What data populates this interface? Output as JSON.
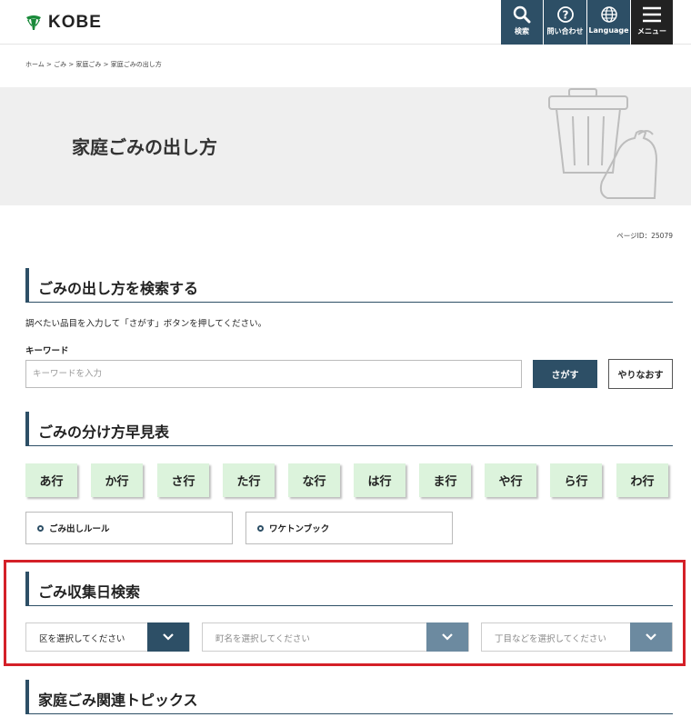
{
  "header": {
    "logo_text": "KOBE",
    "buttons": [
      {
        "label": "検索",
        "icon": "search-icon"
      },
      {
        "label": "問い合わせ",
        "icon": "question-icon"
      },
      {
        "label": "Language",
        "icon": "globe-icon"
      },
      {
        "label": "メニュー",
        "icon": "hamburger-menu-icon"
      }
    ]
  },
  "breadcrumb": "ホーム > ごみ > 家庭ごみ > 家庭ごみの出し方",
  "page_title": "家庭ごみの出し方",
  "page_id": "ページID：25079",
  "search_section": {
    "heading": "ごみの出し方を検索する",
    "intro": "調べたい品目を入力して「さがす」ボタンを押してください。",
    "keyword_label": "キーワード",
    "keyword_placeholder": "キーワードを入力",
    "search_button": "さがす",
    "reset_button": "やりなおす"
  },
  "sorting_section": {
    "heading": "ごみの分け方早見表",
    "rows": [
      "あ行",
      "か行",
      "さ行",
      "た行",
      "な行",
      "は行",
      "ま行",
      "や行",
      "ら行",
      "わ行"
    ],
    "links": [
      "ごみ出しルール",
      "ワケトンブック"
    ]
  },
  "collection_section": {
    "heading": "ごみ収集日検索",
    "selects": [
      {
        "label": "区を選択してください",
        "state": "active"
      },
      {
        "label": "町名を選択してください",
        "state": "disabled"
      },
      {
        "label": "丁目などを選択してください",
        "state": "disabled"
      }
    ]
  },
  "topics_section": {
    "heading": "家庭ごみ関連トピックス"
  },
  "colors": {
    "accent": "#2d4f66",
    "row_button_bg": "#dcf3dc",
    "highlight_frame": "#d42028"
  }
}
